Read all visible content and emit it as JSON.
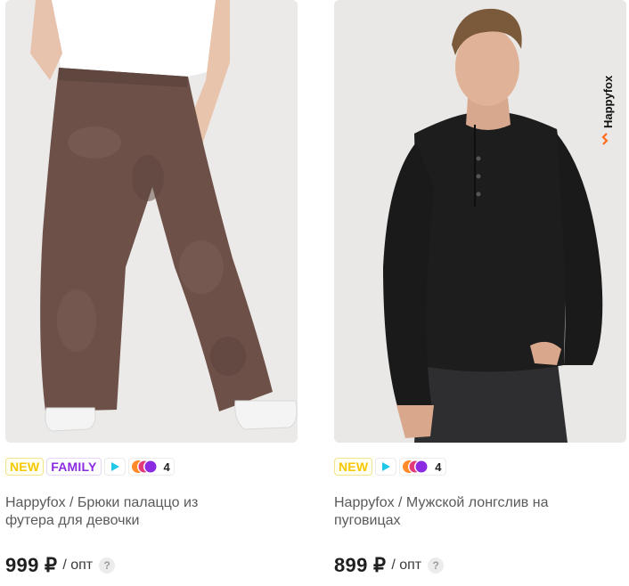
{
  "products": [
    {
      "badges": {
        "new": "NEW",
        "family": "FAMILY",
        "colors_count": "4"
      },
      "title": "Happyfox / Брюки палаццо из\nфутера для девочки",
      "price": "999 ₽",
      "price_unit": "/ опт",
      "help": "?"
    },
    {
      "brand_logo": "Happyfox",
      "badges": {
        "new": "NEW",
        "colors_count": "4"
      },
      "title": "Happyfox / Мужской лонгслив на\nпуговицах",
      "price": "899 ₽",
      "price_unit": "/ опт",
      "help": "?"
    }
  ],
  "colors": {
    "new_badge": "#f5c800",
    "family_badge": "#8a2be2",
    "play_icon": "#1ec8e6",
    "circle_orange": "#ff8a2b",
    "circle_purple": "#8a2be2",
    "pants": "#6d5149",
    "sweater": "#1d1d1d",
    "jeans": "#2e2e30"
  }
}
